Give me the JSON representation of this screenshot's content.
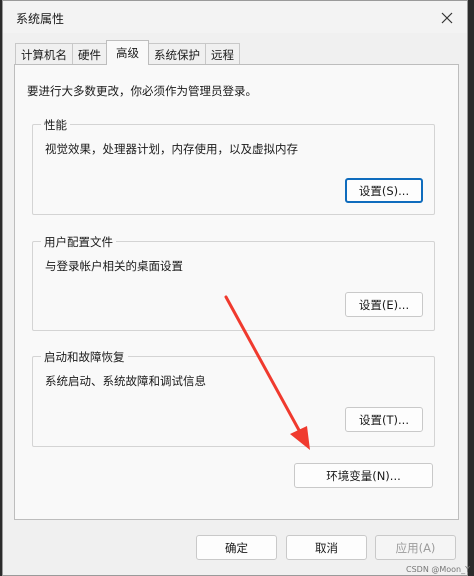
{
  "window": {
    "title": "系统属性"
  },
  "tabs": [
    {
      "label": "计算机名"
    },
    {
      "label": "硬件"
    },
    {
      "label": "高级"
    },
    {
      "label": "系统保护"
    },
    {
      "label": "远程"
    }
  ],
  "notice": "要进行大多数更改，你必须作为管理员登录。",
  "groups": {
    "performance": {
      "label": "性能",
      "desc": "视觉效果，处理器计划，内存使用，以及虚拟内存",
      "button": "设置(S)..."
    },
    "profiles": {
      "label": "用户配置文件",
      "desc": "与登录帐户相关的桌面设置",
      "button": "设置(E)..."
    },
    "startup": {
      "label": "启动和故障恢复",
      "desc": "系统启动、系统故障和调试信息",
      "button": "设置(T)..."
    }
  },
  "env_button": "环境变量(N)...",
  "footer": {
    "ok": "确定",
    "cancel": "取消",
    "apply": "应用(A)"
  },
  "watermark": "CSDN @Moon_Y",
  "colors": {
    "arrow": "#f03a2e",
    "focus": "#0f6cbd"
  }
}
